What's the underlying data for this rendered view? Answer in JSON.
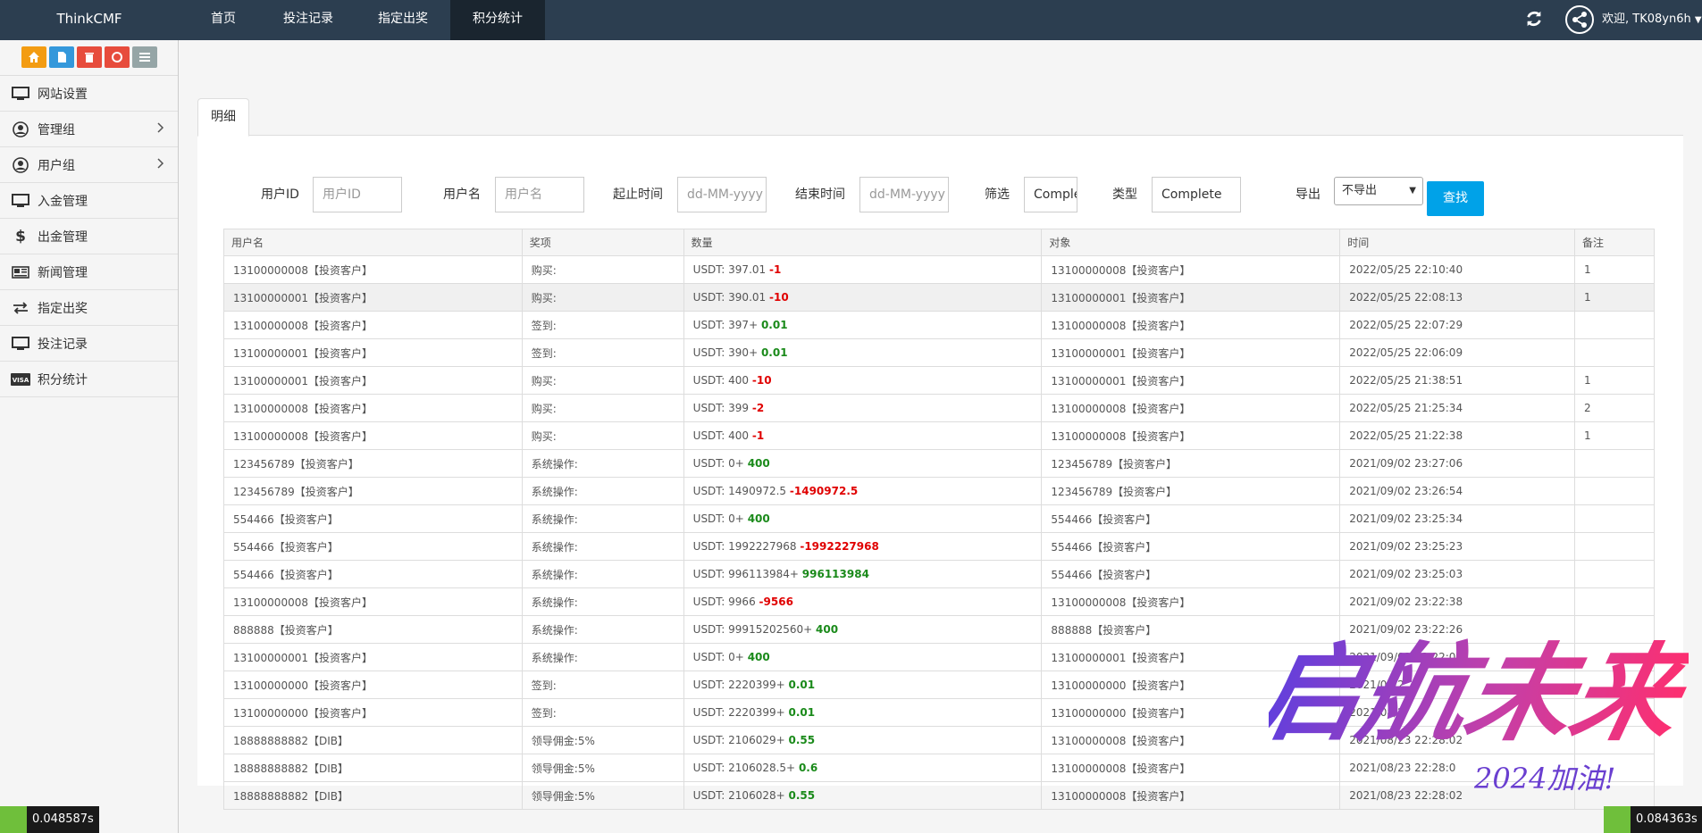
{
  "app": {
    "brand": "ThinkCMF"
  },
  "topnav": {
    "items": [
      "首页",
      "投注记录",
      "指定出奖",
      "积分统计"
    ],
    "active": "积分统计",
    "welcome": "欢迎, TK08yn6h",
    "icons": [
      "refresh-icon",
      "avatar",
      "caret-down-icon"
    ]
  },
  "shortcuts": [
    {
      "name": "home-icon",
      "color": "#f39c12"
    },
    {
      "name": "file-icon",
      "color": "#3498db"
    },
    {
      "name": "trash-icon",
      "color": "#e74c3c"
    },
    {
      "name": "recycle-icon",
      "color": "#e74c3c"
    },
    {
      "name": "list-icon",
      "color": "#95a5a6"
    }
  ],
  "sidebar": {
    "items": [
      {
        "label": "网站设置",
        "icon": "monitor-icon"
      },
      {
        "label": "管理组",
        "icon": "user-circle-icon"
      },
      {
        "label": "用户组",
        "icon": "user-circle-icon"
      },
      {
        "label": "入金管理",
        "icon": "monitor-icon"
      },
      {
        "label": "出金管理",
        "icon": "dollar-icon"
      },
      {
        "label": "新闻管理",
        "icon": "newspaper-icon"
      },
      {
        "label": "指定出奖",
        "icon": "exchange-icon"
      },
      {
        "label": "投注记录",
        "icon": "monitor-icon"
      },
      {
        "label": "积分统计",
        "icon": "visa-icon"
      }
    ]
  },
  "tabs": {
    "detail": "明细"
  },
  "filters": {
    "user_id_label": "用户ID",
    "user_id_placeholder": "用户ID",
    "username_label": "用户名",
    "username_placeholder": "用户名",
    "start_label": "起止时间",
    "start_placeholder": "dd-MM-yyyy",
    "end_label": "结束时间",
    "end_placeholder": "dd-MM-yyyy",
    "filter_label": "筛选",
    "filter_value": "Comple",
    "type_label": "类型",
    "type_value": "Complete",
    "export_label": "导出",
    "export_value": "不导出",
    "search_button": "查找"
  },
  "table": {
    "headers": [
      "用户名",
      "奖项",
      "数量",
      "对象",
      "时间",
      "备注"
    ],
    "rows": [
      {
        "user": "13100000008【投资客户】",
        "award": "购买:",
        "base": "USDT: 397.01",
        "delta": "-1",
        "sign": "neg",
        "target": "13100000008【投资客户】",
        "time": "2022/05/25 22:10:40",
        "note": "1"
      },
      {
        "user": "13100000001【投资客户】",
        "award": "购买:",
        "base": "USDT: 390.01",
        "delta": "-10",
        "sign": "neg",
        "target": "13100000001【投资客户】",
        "time": "2022/05/25 22:08:13",
        "note": "1"
      },
      {
        "user": "13100000008【投资客户】",
        "award": "签到:",
        "base": "USDT: 397+",
        "delta": "0.01",
        "sign": "pos",
        "target": "13100000008【投资客户】",
        "time": "2022/05/25 22:07:29",
        "note": ""
      },
      {
        "user": "13100000001【投资客户】",
        "award": "签到:",
        "base": "USDT: 390+",
        "delta": "0.01",
        "sign": "pos",
        "target": "13100000001【投资客户】",
        "time": "2022/05/25 22:06:09",
        "note": ""
      },
      {
        "user": "13100000001【投资客户】",
        "award": "购买:",
        "base": "USDT: 400",
        "delta": "-10",
        "sign": "neg",
        "target": "13100000001【投资客户】",
        "time": "2022/05/25 21:38:51",
        "note": "1"
      },
      {
        "user": "13100000008【投资客户】",
        "award": "购买:",
        "base": "USDT: 399",
        "delta": "-2",
        "sign": "neg",
        "target": "13100000008【投资客户】",
        "time": "2022/05/25 21:25:34",
        "note": "2"
      },
      {
        "user": "13100000008【投资客户】",
        "award": "购买:",
        "base": "USDT: 400",
        "delta": "-1",
        "sign": "neg",
        "target": "13100000008【投资客户】",
        "time": "2022/05/25 21:22:38",
        "note": "1"
      },
      {
        "user": "123456789【投资客户】",
        "award": "系统操作:",
        "base": "USDT: 0+",
        "delta": "400",
        "sign": "pos",
        "target": "123456789【投资客户】",
        "time": "2021/09/02 23:27:06",
        "note": ""
      },
      {
        "user": "123456789【投资客户】",
        "award": "系统操作:",
        "base": "USDT: 1490972.5",
        "delta": "-1490972.5",
        "sign": "neg",
        "target": "123456789【投资客户】",
        "time": "2021/09/02 23:26:54",
        "note": ""
      },
      {
        "user": "554466【投资客户】",
        "award": "系统操作:",
        "base": "USDT: 0+",
        "delta": "400",
        "sign": "pos",
        "target": "554466【投资客户】",
        "time": "2021/09/02 23:25:34",
        "note": ""
      },
      {
        "user": "554466【投资客户】",
        "award": "系统操作:",
        "base": "USDT: 1992227968",
        "delta": "-1992227968",
        "sign": "neg",
        "target": "554466【投资客户】",
        "time": "2021/09/02 23:25:23",
        "note": ""
      },
      {
        "user": "554466【投资客户】",
        "award": "系统操作:",
        "base": "USDT: 996113984+",
        "delta": "996113984",
        "sign": "pos",
        "target": "554466【投资客户】",
        "time": "2021/09/02 23:25:03",
        "note": ""
      },
      {
        "user": "13100000008【投资客户】",
        "award": "系统操作:",
        "base": "USDT: 9966",
        "delta": "-9566",
        "sign": "neg",
        "target": "13100000008【投资客户】",
        "time": "2021/09/02 23:22:38",
        "note": ""
      },
      {
        "user": "888888【投资客户】",
        "award": "系统操作:",
        "base": "USDT: 99915202560+",
        "delta": "400",
        "sign": "pos",
        "target": "888888【投资客户】",
        "time": "2021/09/02 23:22:26",
        "note": ""
      },
      {
        "user": "13100000001【投资客户】",
        "award": "系统操作:",
        "base": "USDT: 0+",
        "delta": "400",
        "sign": "pos",
        "target": "13100000001【投资客户】",
        "time": "2021/09/02 23:22:05",
        "note": ""
      },
      {
        "user": "13100000000【投资客户】",
        "award": "签到:",
        "base": "USDT: 2220399+",
        "delta": "0.01",
        "sign": "pos",
        "target": "13100000000【投资客户】",
        "time": "2021/08/2",
        "note": ""
      },
      {
        "user": "13100000000【投资客户】",
        "award": "签到:",
        "base": "USDT: 2220399+",
        "delta": "0.01",
        "sign": "pos",
        "target": "13100000000【投资客户】",
        "time": "2021/08/2",
        "note": ""
      },
      {
        "user": "18888888882【DIB】",
        "award": "领导佣金:5%",
        "base": "USDT: 2106029+",
        "delta": "0.55",
        "sign": "pos",
        "target": "13100000008【投资客户】",
        "time": "2021/08/23 22:28:02",
        "note": ""
      },
      {
        "user": "18888888882【DIB】",
        "award": "领导佣金:5%",
        "base": "USDT: 2106028.5+",
        "delta": "0.6",
        "sign": "pos",
        "target": "13100000008【投资客户】",
        "time": "2021/08/23 22:28:0",
        "note": ""
      },
      {
        "user": "18888888882【DIB】",
        "award": "领导佣金:5%",
        "base": "USDT: 2106028+",
        "delta": "0.55",
        "sign": "pos",
        "target": "13100000008【投资客户】",
        "time": "2021/08/23 22:28:02",
        "note": ""
      }
    ]
  },
  "timers": {
    "left": "0.048587s",
    "right": "0.084363s"
  },
  "watermark": {
    "main": "启航未来",
    "sub": "2024加油!"
  }
}
